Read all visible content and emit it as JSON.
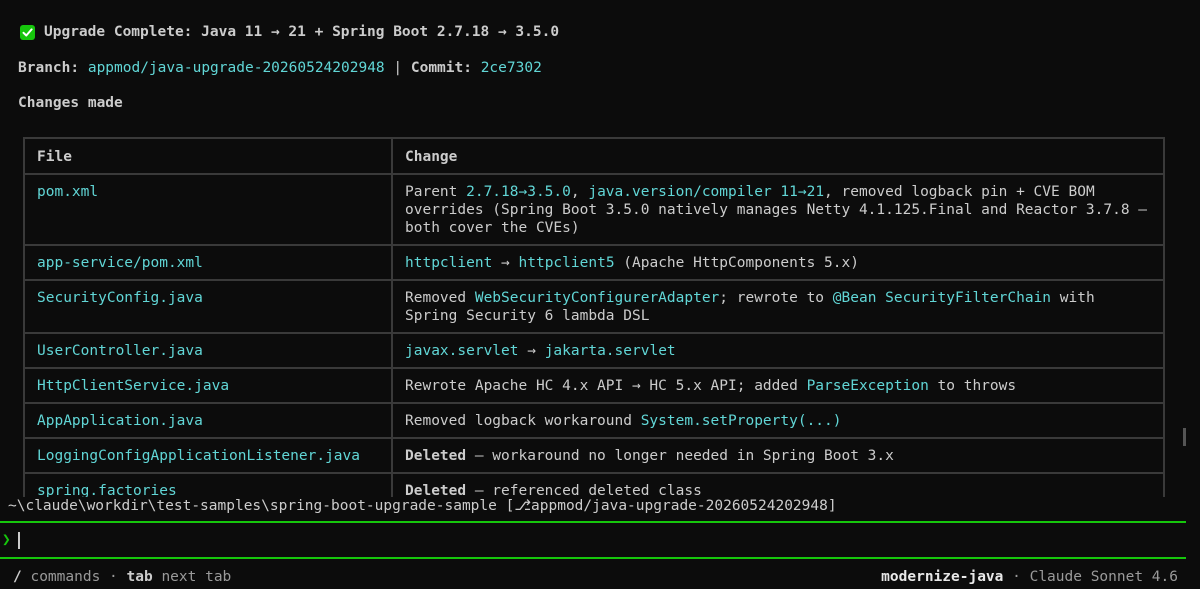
{
  "output": {
    "title": "Upgrade Complete: Java 11 → 21 + Spring Boot 2.7.18 → 3.5.0",
    "branch_label": "Branch:",
    "branch_value": "appmod/java-upgrade-20260524202948",
    "separator": "|",
    "commit_label": "Commit:",
    "commit_value": "2ce7302",
    "changes_heading": "Changes made",
    "table": {
      "headers": [
        "File",
        "Change"
      ],
      "rows": [
        {
          "file": "pom.xml",
          "change": [
            {
              "t": "Parent ",
              "s": "n"
            },
            {
              "t": "2.7.18→3.5.0",
              "s": "c"
            },
            {
              "t": ", ",
              "s": "n"
            },
            {
              "t": "java.version/compiler 11→21",
              "s": "c"
            },
            {
              "t": ", removed logback pin + CVE BOM overrides (Spring Boot 3.5.0 natively manages Netty 4.1.125.Final and Reactor 3.7.8 — both cover the CVEs)",
              "s": "n"
            }
          ]
        },
        {
          "file": "app-service/pom.xml",
          "change": [
            {
              "t": "httpclient",
              "s": "c"
            },
            {
              "t": " → ",
              "s": "n"
            },
            {
              "t": "httpclient5",
              "s": "c"
            },
            {
              "t": " (Apache HttpComponents 5.x)",
              "s": "n"
            }
          ]
        },
        {
          "file": "SecurityConfig.java",
          "change": [
            {
              "t": "Removed ",
              "s": "n"
            },
            {
              "t": "WebSecurityConfigurerAdapter",
              "s": "c"
            },
            {
              "t": "; rewrote to ",
              "s": "n"
            },
            {
              "t": "@Bean SecurityFilterChain",
              "s": "c"
            },
            {
              "t": " with Spring Security 6 lambda DSL",
              "s": "n"
            }
          ]
        },
        {
          "file": "UserController.java",
          "change": [
            {
              "t": "javax.servlet",
              "s": "c"
            },
            {
              "t": " → ",
              "s": "n"
            },
            {
              "t": "jakarta.servlet",
              "s": "c"
            }
          ]
        },
        {
          "file": "HttpClientService.java",
          "change": [
            {
              "t": "Rewrote Apache HC 4.x API → HC 5.x API; added ",
              "s": "n"
            },
            {
              "t": "ParseException",
              "s": "c"
            },
            {
              "t": " to throws",
              "s": "n"
            }
          ]
        },
        {
          "file": "AppApplication.java",
          "change": [
            {
              "t": "Removed logback workaround ",
              "s": "n"
            },
            {
              "t": "System.setProperty(...)",
              "s": "c"
            }
          ]
        },
        {
          "file": "LoggingConfigApplicationListener.java",
          "change": [
            {
              "t": "Deleted",
              "s": "b"
            },
            {
              "t": " — workaround no longer needed in Spring Boot 3.x",
              "s": "n"
            }
          ]
        },
        {
          "file": "spring.factories",
          "change": [
            {
              "t": "Deleted",
              "s": "b"
            },
            {
              "t": " — referenced deleted class",
              "s": "n"
            }
          ]
        }
      ]
    }
  },
  "cwd_line": "~\\claude\\workdir\\test-samples\\spring-boot-upgrade-sample [⎇appmod/java-upgrade-20260524202948]",
  "prompt": {
    "symbol": "❯",
    "value": ""
  },
  "footer": {
    "hint_slash": "/",
    "hint_commands": "commands",
    "hint_dot": "·",
    "hint_tab": "tab",
    "hint_next_tab": "next tab",
    "mode": "modernize-java",
    "status_dot": "·",
    "model": "Claude Sonnet 4.6"
  },
  "colors": {
    "accent_green": "#16c60c",
    "cyan": "#61d6d6",
    "text": "#cccccc",
    "border": "#3a3a3a",
    "background": "#0c0c0c"
  }
}
